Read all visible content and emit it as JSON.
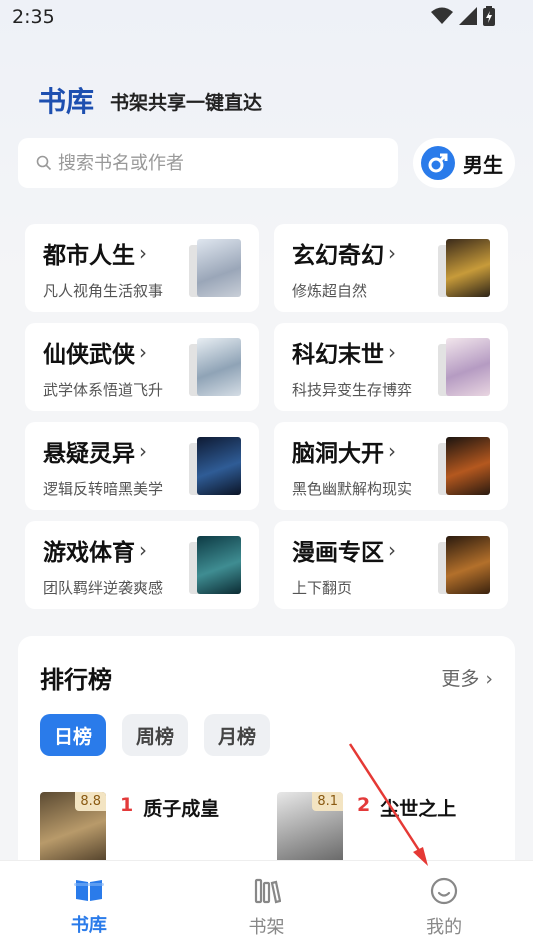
{
  "status_bar": {
    "time": "2:35"
  },
  "header": {
    "title": "书库",
    "slogan": "书架共享一键直达"
  },
  "search": {
    "placeholder": "搜索书名或作者"
  },
  "gender": {
    "label": "男生"
  },
  "categories": [
    {
      "name": "都市人生",
      "desc": "凡人视角生活叙事"
    },
    {
      "name": "玄幻奇幻",
      "desc": "修炼超自然"
    },
    {
      "name": "仙侠武侠",
      "desc": "武学体系悟道飞升"
    },
    {
      "name": "科幻末世",
      "desc": "科技异变生存博弈"
    },
    {
      "name": "悬疑灵异",
      "desc": "逻辑反转暗黑美学"
    },
    {
      "name": "脑洞大开",
      "desc": "黑色幽默解构现实"
    },
    {
      "name": "游戏体育",
      "desc": "团队羁绊逆袭爽感"
    },
    {
      "name": "漫画专区",
      "desc": "上下翻页"
    }
  ],
  "ranking": {
    "title": "排行榜",
    "more": "更多",
    "tabs": [
      "日榜",
      "周榜",
      "月榜"
    ],
    "active_tab": "日榜",
    "items": [
      {
        "rank": "1",
        "name": "质子成皇",
        "score": "8.8"
      },
      {
        "rank": "2",
        "name": "尘世之上",
        "score": "8.1"
      }
    ]
  },
  "tab_bar": {
    "items": [
      {
        "label": "书库",
        "icon": "book-open-icon"
      },
      {
        "label": "书架",
        "icon": "bookshelf-icon"
      },
      {
        "label": "我的",
        "icon": "smile-icon"
      }
    ],
    "active": "书库"
  },
  "colors": {
    "accent": "#2a7bea",
    "brand_title": "#1d4fb0",
    "rank_red": "#e33a3a"
  }
}
